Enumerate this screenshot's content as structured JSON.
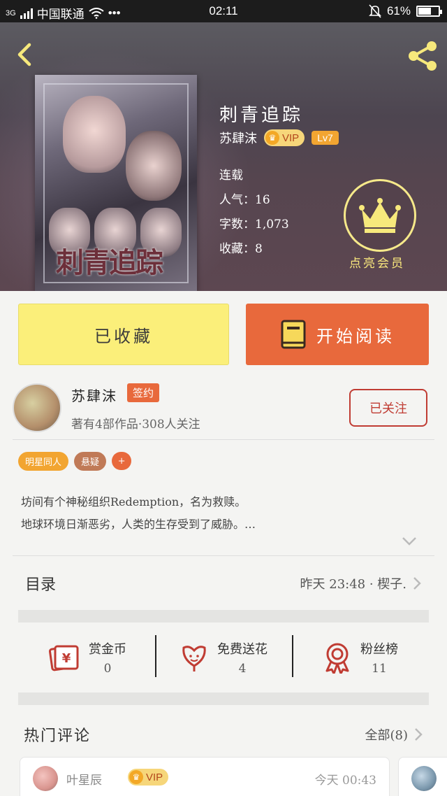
{
  "status_bar": {
    "network": "3G",
    "carrier": "中国联通",
    "more": "•••",
    "time": "02:11",
    "battery": "61%",
    "battery_level": 0.61
  },
  "book": {
    "title": "刺青追踪",
    "author": "苏肆沫",
    "vip_label": "VIP",
    "level": "Lv7",
    "status": "连载",
    "popularity": "人气：16",
    "word_count": "字数：1,073",
    "favorites": "收藏：8",
    "cover_title": "刺青追踪",
    "member_label": "点亮会员"
  },
  "actions": {
    "favorited_label": "已收藏",
    "read_label": "开始阅读"
  },
  "author_info": {
    "name": "苏肆沫",
    "signed_tag": "签约",
    "stats": "著有4部作品·308人关注",
    "follow_label": "已关注"
  },
  "tags": [
    "明星同人",
    "悬疑",
    "+"
  ],
  "description": {
    "line1": "坊间有个神秘组织Redemption，名为救赎。",
    "line2": "地球环境日渐恶劣，人类的生存受到了威胁。…"
  },
  "toc": {
    "label": "目录",
    "latest": "昨天 23:48 · 楔子."
  },
  "stats": [
    {
      "label": "赏金币",
      "value": "0"
    },
    {
      "label": "免费送花",
      "value": "4"
    },
    {
      "label": "粉丝榜",
      "value": "11"
    }
  ],
  "comments": {
    "heading": "热门评论",
    "all_label": "全部(8)",
    "first": {
      "name": "叶星辰",
      "vip": "VIP",
      "time": "今天 00:43"
    }
  },
  "colors": {
    "accent_orange": "#e8693c",
    "accent_yellow": "#fbef7a",
    "follow_red": "#c03c33",
    "tag_orange": "#f2a531",
    "tag_brown": "#c07a57",
    "member_gold": "#f6e98a"
  }
}
